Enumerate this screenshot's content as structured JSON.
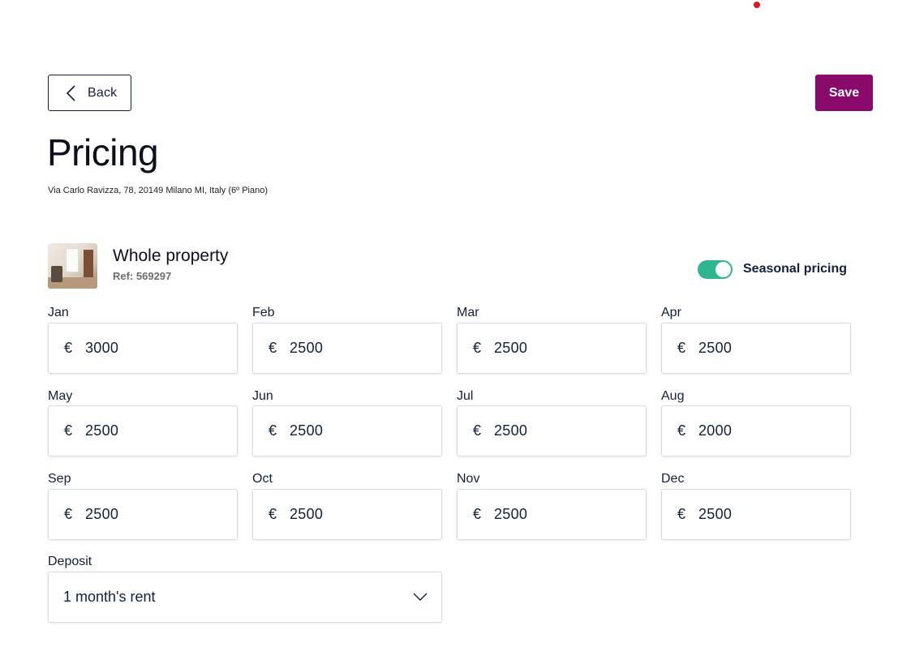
{
  "header": {
    "back_label": "Back",
    "save_label": "Save",
    "accent_color": "#8a0a6b",
    "notification_color": "#e0161f"
  },
  "page": {
    "title": "Pricing",
    "address": "Via Carlo Ravizza, 78, 20149 Milano MI, Italy (6º Piano)"
  },
  "property": {
    "name": "Whole property",
    "ref": "Ref: 569297"
  },
  "seasonal": {
    "label": "Seasonal pricing",
    "enabled": true,
    "toggle_color": "#2fb58f"
  },
  "currency_symbol": "€",
  "months": [
    {
      "label": "Jan",
      "value": "3000"
    },
    {
      "label": "Feb",
      "value": "2500"
    },
    {
      "label": "Mar",
      "value": "2500"
    },
    {
      "label": "Apr",
      "value": "2500"
    },
    {
      "label": "May",
      "value": "2500"
    },
    {
      "label": "Jun",
      "value": "2500"
    },
    {
      "label": "Jul",
      "value": "2500"
    },
    {
      "label": "Aug",
      "value": "2000"
    },
    {
      "label": "Sep",
      "value": "2500"
    },
    {
      "label": "Oct",
      "value": "2500"
    },
    {
      "label": "Nov",
      "value": "2500"
    },
    {
      "label": "Dec",
      "value": "2500"
    }
  ],
  "deposit": {
    "label": "Deposit",
    "selected": "1 month's rent"
  },
  "icons": {
    "back": "chevron-left-icon",
    "deposit": "chevron-down-icon"
  }
}
